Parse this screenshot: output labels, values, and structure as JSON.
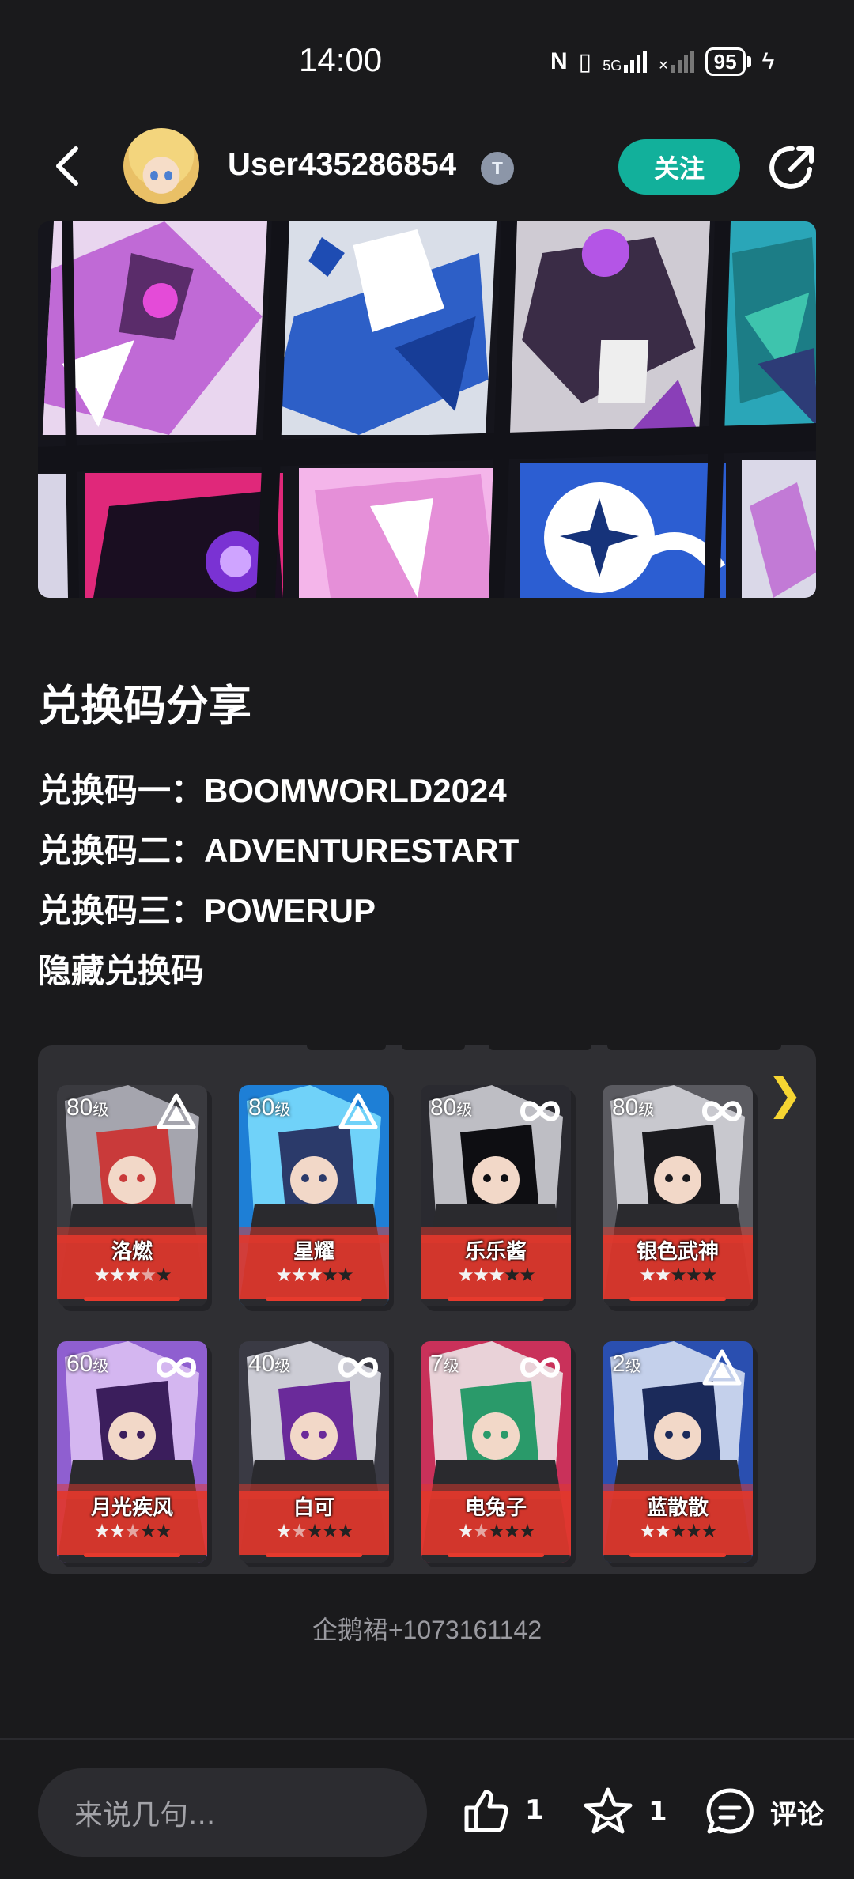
{
  "status_bar": {
    "time": "14:00",
    "nfc_icon": "N",
    "vibrate_icon": "▯",
    "network_label": "5G",
    "battery_level": "95"
  },
  "header": {
    "username": "User435286854",
    "verify_badge": "T",
    "follow_label": "关注"
  },
  "article": {
    "title": "兑换码分享",
    "lines": [
      "兑换码一：BOOMWORLD2024",
      "兑换码二：ADVENTURESTART",
      "兑换码三：POWERUP",
      "隐藏兑换码"
    ],
    "qq_group": "企鹅裙+1073161142"
  },
  "characters": [
    {
      "level": "80",
      "unit": "级",
      "name": "洛燃",
      "stars": 3.5,
      "type_icon": "triangle-icon"
    },
    {
      "level": "80",
      "unit": "级",
      "name": "星耀",
      "stars": 3,
      "type_icon": "triangle-icon"
    },
    {
      "level": "80",
      "unit": "级",
      "name": "乐乐酱",
      "stars": 3,
      "type_icon": "infinity-icon"
    },
    {
      "level": "80",
      "unit": "级",
      "name": "银色武神",
      "stars": 2,
      "type_icon": "infinity-icon"
    },
    {
      "level": "60",
      "unit": "级",
      "name": "月光疾风",
      "stars": 2.5,
      "type_icon": "infinity-icon"
    },
    {
      "level": "40",
      "unit": "级",
      "name": "白可",
      "stars": 1.5,
      "type_icon": "infinity-icon"
    },
    {
      "level": "7",
      "unit": "级",
      "name": "电兔子",
      "stars": 1.5,
      "type_icon": "infinity-icon"
    },
    {
      "level": "2",
      "unit": "级",
      "name": "蓝散散",
      "stars": 2,
      "type_icon": "triangle-icon"
    }
  ],
  "bottom_bar": {
    "comment_placeholder": "来说几句...",
    "like_count": "1",
    "favorite_count": "1",
    "comment_label": "评论"
  },
  "colors": {
    "background": "#1a1a1c",
    "accent": "#12b09b",
    "arrow": "#f6d532",
    "card_red": "#e73a2d"
  }
}
